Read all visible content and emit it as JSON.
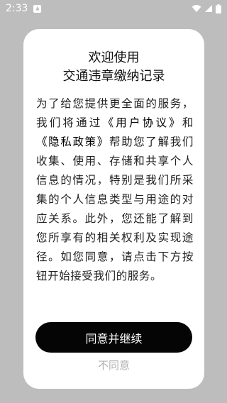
{
  "status_bar": {
    "time": "2:33",
    "icons": [
      "notification-icon",
      "wifi-icon",
      "signal-icon",
      "battery-icon"
    ]
  },
  "dialog": {
    "title_line1": "欢迎使用",
    "title_line2": "交通违章缴纳记录",
    "body_part1": "为了给您提供更全面的服务，我们将通过",
    "user_agreement_link": "《用户协议》",
    "body_and": "和",
    "privacy_policy_link": "《隐私政策》",
    "body_part2": "帮助您了解我们收集、使用、存储和共享个人信息的情况，特别是我们所采集的个人信息类型与用途的对应关系。此外，您还能了解到您所享有的相关权利及实现途径。如您同意，请点击下方按钮开始接受我们的服务。",
    "agree_button": "同意并继续",
    "disagree_button": "不同意"
  },
  "colors": {
    "overlay_background": "#bdbdbd",
    "dialog_background": "#ffffff",
    "primary_button": "#050505",
    "secondary_text": "#b0b0b0"
  }
}
